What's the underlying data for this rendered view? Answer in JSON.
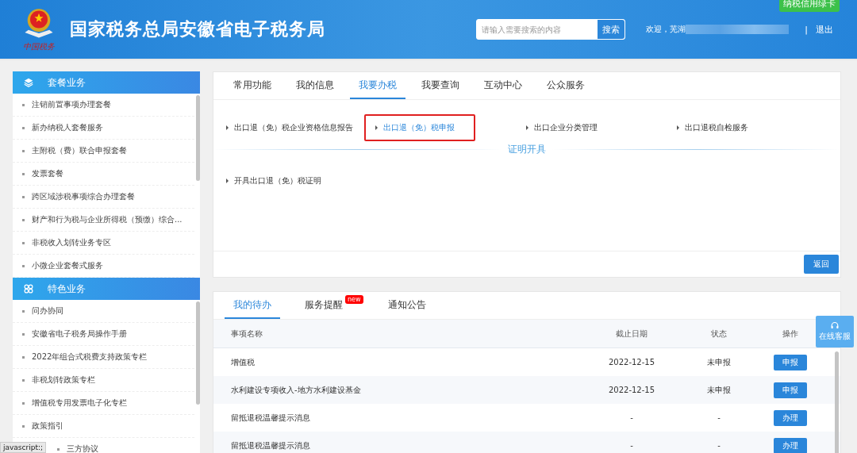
{
  "header": {
    "title": "国家税务总局安徽省电子税务局",
    "logo_text": "中国税务",
    "search": {
      "placeholder": "请输入需要搜索的内容",
      "button": "搜索"
    },
    "welcome": "欢迎，芜湖",
    "logout_separator": "|",
    "logout": "退出",
    "badge": "纳税信用绿卡"
  },
  "sidebar": {
    "sections": [
      {
        "title": "套餐业务",
        "items": [
          "注销前置事项办理套餐",
          "新办纳税人套餐服务",
          "主附税（费）联合申报套餐",
          "发票套餐",
          "跨区域涉税事项综合办理套餐",
          "财产和行为税与企业所得税（预缴）综合...",
          "非税收入划转业务专区",
          "小微企业套餐式服务"
        ]
      },
      {
        "title": "特色业务",
        "items": [
          "问办协同",
          "安徽省电子税务局操作手册",
          "2022年组合式税费支持政策专栏",
          "非税划转政策专栏",
          "增值税专用发票电子化专栏",
          "政策指引",
          "三方协议"
        ]
      }
    ]
  },
  "main_tabs": [
    {
      "label": "常用功能",
      "selected": false
    },
    {
      "label": "我的信息",
      "selected": false
    },
    {
      "label": "我要办税",
      "selected": true
    },
    {
      "label": "我要查询",
      "selected": false
    },
    {
      "label": "互动中心",
      "selected": false
    },
    {
      "label": "公众服务",
      "selected": false
    }
  ],
  "links": [
    {
      "label": "出口退（免）税企业资格信息报告",
      "selected": false
    },
    {
      "label": "出口退（免）税申报",
      "selected": true
    },
    {
      "label": "出口企业分类管理",
      "selected": false
    },
    {
      "label": "出口退税自检服务",
      "selected": false
    }
  ],
  "section_divider": "证明开具",
  "cert_links": [
    {
      "label": "开具出口退（免）税证明",
      "selected": false
    }
  ],
  "back_button": "返回",
  "todo_tabs": [
    {
      "label": "我的待办",
      "selected": true
    },
    {
      "label": "服务提醒",
      "selected": false,
      "badge": "new"
    },
    {
      "label": "通知公告",
      "selected": false
    }
  ],
  "table": {
    "columns": [
      "事项名称",
      "截止日期",
      "状态",
      "操作"
    ],
    "rows": [
      {
        "name": "增值税",
        "deadline": "2022-12-15",
        "status": "未申报",
        "action": "申报"
      },
      {
        "name": "水利建设专项收入-地方水利建设基金",
        "deadline": "2022-12-15",
        "status": "未申报",
        "action": "申报"
      },
      {
        "name": "留抵退税温馨提示消息",
        "deadline": "-",
        "status": "-",
        "action": "办理"
      },
      {
        "name": "留抵退税温馨提示消息",
        "deadline": "-",
        "status": "-",
        "action": "办理"
      }
    ]
  },
  "online_service": "在线客服",
  "status_tooltip": "javascript:;"
}
